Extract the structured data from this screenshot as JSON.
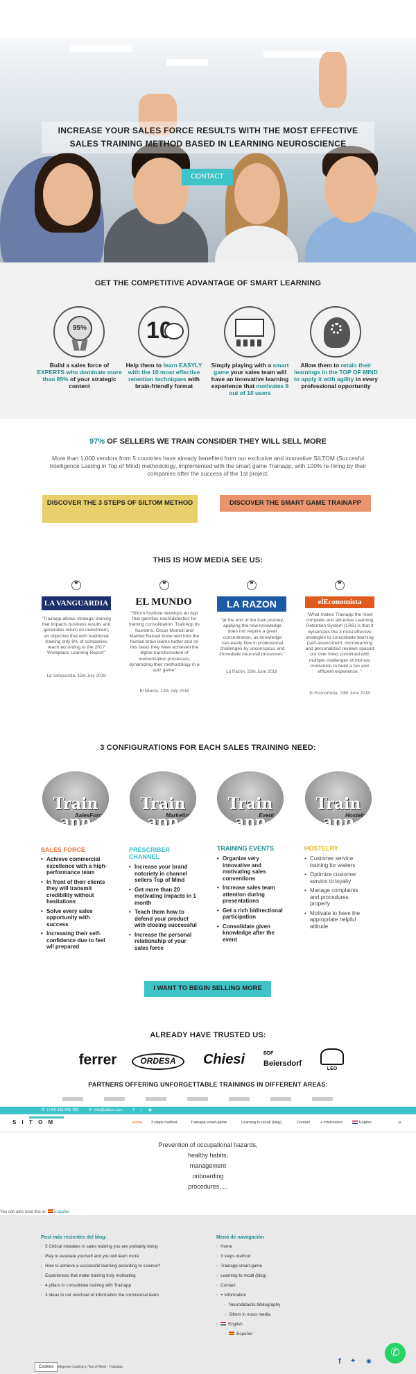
{
  "hero": {
    "title_line1": "INCREASE YOUR SALES FORCE RESULTS WITH THE MOST EFFECTIVE",
    "title_line2": "SALES TRAINING METHOD BASED IN LEARNING NEUROSCIENCE",
    "contact_label": "CONTACT"
  },
  "advantage": {
    "title": "GET THE COMPETITIVE ADVANTAGE OF SMART LEARNING",
    "items": [
      {
        "icon": "medal-95-icon",
        "badge": "95%",
        "pre": "Build a sales force of ",
        "hl": "EXPERTS who dominate more than 95%",
        "post": " of your strategic content"
      },
      {
        "icon": "ten-brain-icon",
        "badge": "10",
        "pre": "Help them to ",
        "hl": "learn EASYLY with the 10 most effective retention techniques",
        "post": " with brain-friendly format"
      },
      {
        "icon": "team-screen-icon",
        "badge": "",
        "pre": "Simply playing with a ",
        "hl": "smart game",
        "post": " your sales team will have an innovative learning experience that ",
        "hl2": "motivates 9 out of 10 users"
      },
      {
        "icon": "head-gears-icon",
        "badge": "",
        "pre": "Allow them to ",
        "hl": "retain their learnings in the TOP OF MIND to apply it with agility",
        "post": " in every professional opportunity"
      }
    ]
  },
  "stats": {
    "pct": "97%",
    "pct_text": " OF SELLERS WE TRAIN CONSIDER THEY WILL SELL MORE",
    "body": "More than 1,000 vendors from 5 countries have already benefited from our exclusive and innovative SILTOM (Succesful Intelligence Lasting in Top of Mind) methodology, implemented with the smart game Trainapp, with 100% re-hiring by their companies after the success of the 1st project.",
    "cta_left": "DISCOVER THE 3 STEPS OF SILTOM METHOD",
    "cta_right": "DISCOVER THE SMART GAME TRAINAPP",
    "colors": {
      "left": "#e8cf6b",
      "right": "#e9946c"
    }
  },
  "media": {
    "title": "THIS IS HOW MEDIA SEE US:",
    "items": [
      {
        "logo": "LA VANGUARDIA",
        "logo_bg": "#1d2f6b",
        "logo_fg": "#ffffff",
        "quote": "\"Trainapp allows strategic training that impacts business results and generates return on investment, an objective that with traditional training only 8% of companies reach according to the 2017 Workplace Learning Report\"",
        "date": "La Vanguardia, 15th July 2018"
      },
      {
        "logo": "EL MUNDO",
        "logo_bg": "#ffffff",
        "logo_fg": "#111111",
        "quote": "\"Siltom Institute develops an App that gamifies neurodidactics for training consolidation. TrainApp its founders, Óscar Montull and Maribel Bainad knew well how the human brain learns better and on this basis they have achieved the digital transformation of memorization processes, dynamizing their methodology in a quiz game\"",
        "date": "El Mundo, 13th July 2018"
      },
      {
        "logo": "LA RAZON",
        "logo_bg": "#1c5aa6",
        "logo_fg": "#ffffff",
        "quote": "\"at the end of the train journey, applying the new knowledge does not require a great concentration, as knowledge can easily flow in professional challenges by unconscious and immediate neuronal processes.\"",
        "date": "La Razón, 20th June 2018"
      },
      {
        "logo": "elEconomista",
        "logo_bg": "#e05a1e",
        "logo_fg": "#ffffff",
        "quote": "\"What makes Trainapp the most complete and attractive Learning Retention System (LRS) is that it dynamizes the 3 most effective strategies to consolidate learning (self-assessment, microlearning and personalized reviews spaced out over time) combined with multiple challenges of intrinsic motivation to build a fun and efficient experience. \"",
        "date": "El Economista, 19th June 2018"
      }
    ]
  },
  "configs": {
    "title": "3 CONFIGURATIONS FOR EACH SALES TRAINING NEED:",
    "items": [
      {
        "img_word": "Train app",
        "img_tag": "SalesForce",
        "title": "SALES FORCE",
        "color": "#e9763f",
        "light": false,
        "points": [
          "Achieve commercial excellence with a high-performance team",
          "In front of their clients they will transmit credibility without hesitations",
          "Solve every sales opportunity with success",
          "Increasing their self-confidence due to feel wll prepared"
        ]
      },
      {
        "img_word": "Train app",
        "img_tag": "Marketing",
        "title": "PRESCRIBER CHANNEL",
        "color": "#3ec3c9",
        "light": false,
        "points": [
          "Increase your brand notoriety in channel sellers Top of Mind",
          "Get more than 20 motivating impacts in 1 month",
          "Teach them how to defend your product with closing successful",
          "Increase the personal relationship of your sales force"
        ]
      },
      {
        "img_word": "Train app",
        "img_tag": "Event",
        "title": "TRAINING EVENTS",
        "color": "#1f8a8f",
        "light": false,
        "points": [
          "Organize very innovative and motivating sales conventions",
          "Increase sales team attention during presentations",
          "Get a rich bidirectional participation",
          "Consolidate given knowledge after the event"
        ]
      },
      {
        "img_word": "Train app",
        "img_tag": "Hostelry",
        "title": "HOSTELRY",
        "color": "#e6b817",
        "light": true,
        "points": [
          "Customer service training for waiters",
          "Optimize customer service to loyalty",
          "Manage complaints and procedures properly",
          "Motivate to have the appropriate helpful attitude"
        ]
      }
    ],
    "cta": "I WANT TO BEGIN SELLING MORE"
  },
  "trusted": {
    "title": "ALREADY HAVE TRUSTED US:",
    "brands": [
      "ferrer",
      "ORDESA",
      "Chiesi",
      "Beiersdorf",
      "LEO"
    ],
    "bdf": "BDF",
    "partners": "PARTNERS OFFERING UNFORGETTABLE TRAININGS IN DIFFERENT AREAS:"
  },
  "topbar": {
    "phone": "(+34) 931 641 783",
    "email": "info@siltom.com"
  },
  "nav": {
    "logo": "S I    T O M",
    "items": [
      "Home",
      "3 steps method",
      "Trainapp smart-game",
      "Learning to recall (blog)",
      "Contact",
      "+ Information",
      "English"
    ]
  },
  "training": {
    "lines": [
      "Prevention of occupational hazards,",
      "healthy habits,",
      "management",
      "onboarding",
      "procedures, ..."
    ]
  },
  "lang_note": {
    "text": "You can also read this in:",
    "lang": "Español"
  },
  "footer": {
    "left_head": "Post más recientes del blog:",
    "left_links": [
      "5 Critical mistakes in sales training you are probably doing",
      "Play to evaluate yourself and you will learn more",
      "How to achieve a successful learning according to science?",
      "Experiences that make training truly motivating",
      "4 pillars to consolidate training with Trainapp",
      "3 ideas to not overload of information the commercial team"
    ],
    "right_head": "Menú de navegación",
    "right_links": [
      "Home",
      "3 steps method",
      "Trainapp smart-game",
      "Learning to recall (blog)",
      "Contact",
      "+ Information"
    ],
    "sub_links": [
      "Neurodidactic bibliography",
      "Siltom in mass media"
    ],
    "lang1": "English",
    "lang2": "Español",
    "bottom_text": "ssful Intelligence Lasting in Top of Mind - Trainapp",
    "cookies": "Cookies"
  }
}
